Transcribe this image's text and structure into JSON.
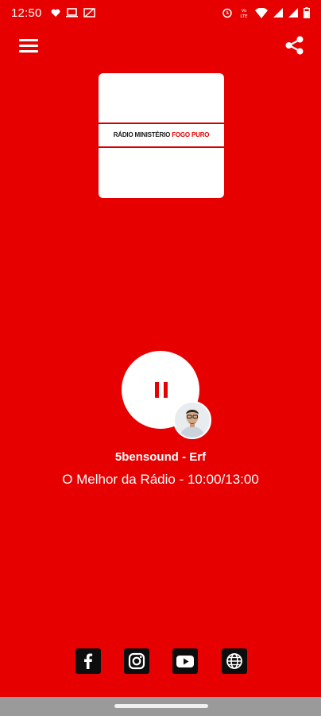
{
  "status_bar": {
    "time": "12:50",
    "icons": [
      "heart-icon",
      "laptop-icon",
      "cast-off-icon",
      "alarm-icon",
      "volte-icon",
      "wifi-icon",
      "signal-icon",
      "signal-icon-2",
      "battery-icon"
    ],
    "volte_text": "Vo\nLTE"
  },
  "app_bar": {
    "menu_icon": "menu-icon",
    "share_icon": "share-icon"
  },
  "logo": {
    "text_main": "RÁDIO MINISTÉRIO ",
    "text_accent": "FOGO PURO",
    "accent_color": "#e60000"
  },
  "player": {
    "state": "playing",
    "control_icon": "pause-icon",
    "track_title": "5bensound - Erf",
    "program_line": "O Melhor da Rádio - 10:00/13:00"
  },
  "socials": [
    {
      "name": "facebook-icon"
    },
    {
      "name": "instagram-icon"
    },
    {
      "name": "youtube-icon"
    },
    {
      "name": "globe-icon"
    }
  ],
  "colors": {
    "background": "#e60000",
    "social_bg": "#0d0d0d",
    "navbar": "#9a9a9a"
  }
}
